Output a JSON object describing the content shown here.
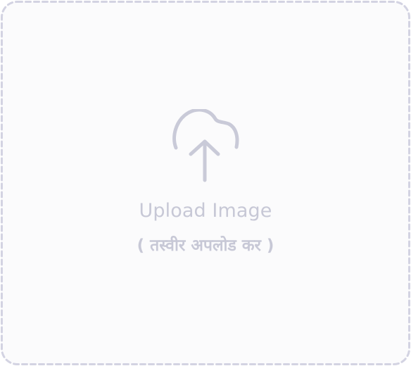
{
  "upload": {
    "title": "Upload Image",
    "subtitle": "( तस्वीर अपलोड कर )",
    "icon": "cloud-upload-icon"
  },
  "colors": {
    "background": "#fbfbfc",
    "border": "#d3d3e2",
    "icon": "#c9cad8",
    "text": "#c7c8d6"
  }
}
